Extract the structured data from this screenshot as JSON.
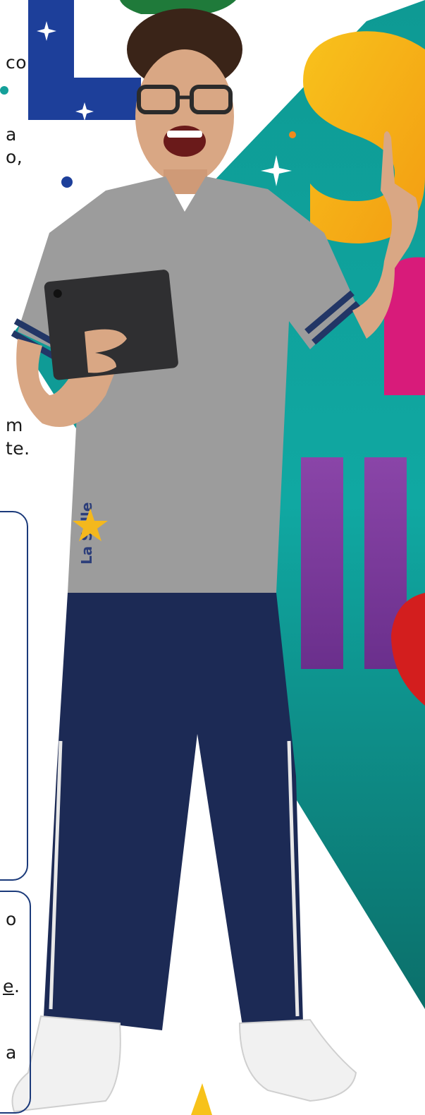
{
  "colors": {
    "teal_dark": "#0a7c7c",
    "teal_light": "#12a6a0",
    "navy_letter": "#1d3f9a",
    "yellow": "#f7b71a",
    "magenta": "#d81b7a",
    "purple": "#7b3a9b",
    "red": "#d31e1e",
    "green_top": "#1f7a3a",
    "shirt": "#9c9c9c",
    "pants": "#1c2a55",
    "card_border": "#1b3a7a",
    "star_logo": "#f4b81d"
  },
  "icons": [
    "sparkle-icon",
    "star-logo-icon",
    "sneaker-icon",
    "tablet-device"
  ],
  "shirt_logo": "La Salle",
  "left_text_fragments": [
    {
      "id": "frag1",
      "text": "co"
    },
    {
      "id": "frag2",
      "text": "a"
    },
    {
      "id": "frag3",
      "text": "o,"
    },
    {
      "id": "frag4",
      "text": "m"
    },
    {
      "id": "frag5",
      "text": "te."
    },
    {
      "id": "frag6",
      "text": "o"
    },
    {
      "id": "frag7",
      "text": "e"
    },
    {
      "id": "frag7b",
      "text": "."
    },
    {
      "id": "frag8",
      "text": "a"
    }
  ]
}
